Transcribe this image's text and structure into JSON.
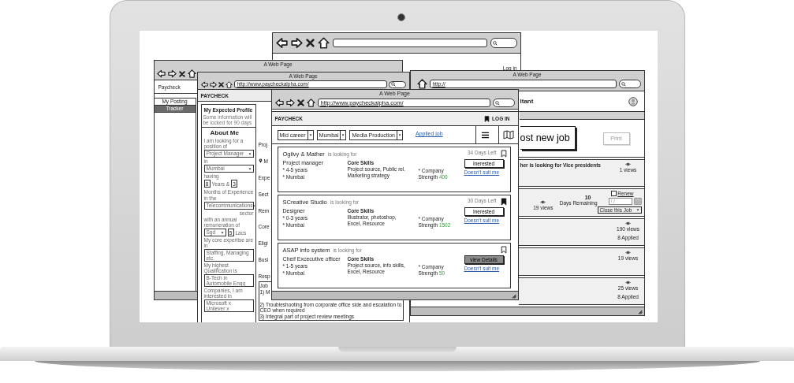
{
  "back_window": {
    "link": "Log in"
  },
  "posting_window": {
    "title": "A Web Page",
    "brand": "Paycheck",
    "menu": [
      {
        "label": "My Posting",
        "selected": false
      },
      {
        "label": "Tracker",
        "selected": true
      }
    ]
  },
  "profile_window": {
    "title": "A Web Page",
    "url": "http://www.paycheckalpha.com/",
    "brand": "PAYCHECK",
    "panel_title": "My Expected Profile",
    "panel_note": "Some information will be locked for 90 days",
    "section_title": "About Me",
    "form": [
      {
        "kind": "label",
        "text": "I am looking for a position of"
      },
      {
        "kind": "select",
        "value": "Project Manager"
      },
      {
        "kind": "label",
        "text": "in"
      },
      {
        "kind": "select",
        "value": "Mumbai"
      },
      {
        "kind": "label",
        "text": "having"
      },
      {
        "kind": "experience",
        "years": "8",
        "years_label": "Years &",
        "months": "3",
        "months_label": "Months of Experience"
      },
      {
        "kind": "label",
        "text": "in the"
      },
      {
        "kind": "select",
        "value": "Telecommunications"
      },
      {
        "kind": "note",
        "text": "sector"
      },
      {
        "kind": "label",
        "text": "with an annual remuneration of"
      },
      {
        "kind": "salary",
        "currency": "Sgd",
        "amount": "5",
        "unit": "Lacs"
      },
      {
        "kind": "label",
        "text": "My core expertise are in"
      },
      {
        "kind": "field",
        "value": "Staffing, Managing etc."
      },
      {
        "kind": "label",
        "text": "My highest Qualification is"
      },
      {
        "kind": "field",
        "value": "B-Tech in Automobile Engg"
      },
      {
        "kind": "label",
        "text": "Companies, I am interested in"
      },
      {
        "kind": "tags",
        "tags": [
          "Microsoft x",
          "Unilever x"
        ]
      }
    ],
    "main_rows": [
      {
        "kind": "label",
        "text": "Proj"
      },
      {
        "kind": "location",
        "text": "M"
      },
      {
        "kind": "label",
        "text": "Expe"
      },
      {
        "kind": "label",
        "text": "Sect"
      },
      {
        "kind": "label",
        "text": "Rem"
      },
      {
        "kind": "label",
        "text": "Core"
      },
      {
        "kind": "label",
        "text": "Eligi"
      },
      {
        "kind": "label",
        "text": "Busi"
      },
      {
        "kind": "label",
        "text": "Resp"
      }
    ],
    "job": {
      "legend": "Job",
      "lines": [
        "1) M",
        "2) Troubleshooting from corporate office side and escalation to CEO when required",
        "3) Integral part of project review meetings"
      ]
    }
  },
  "tracker_window": {
    "title": "A Web Page",
    "url": "http://",
    "brand": "ltant",
    "post_button": "ost new job",
    "print_button": {
      "label": "Print",
      "disabled": true
    },
    "rows": [
      {
        "kind": "posting",
        "title": "her is looking for Vice presidents",
        "views": "1 views"
      },
      {
        "kind": "expiring",
        "days": "10",
        "days_label": "Days Remaining",
        "renew": {
          "label": "Renew",
          "checked": false
        },
        "date_placeholder": "/ /",
        "views": "19 views",
        "close_action": "Close this Job"
      },
      {
        "kind": "posting",
        "views": "190 views",
        "applied": "8 Applied"
      },
      {
        "kind": "posting",
        "views": "19 views"
      },
      {
        "kind": "posting",
        "views": "25 views",
        "applied": "8 Applied"
      }
    ]
  },
  "jobs_window": {
    "title": "A Web Page",
    "url": "http://www.paycheckalpha.com/",
    "brand": "PAYCHECK",
    "login": "LOG IN",
    "filters": [
      "Mid career",
      "Mumbai",
      "Media Production"
    ],
    "applied_link": "Applied job",
    "cards": [
      {
        "company": "Ogilvy & Mather",
        "looking": "is looking for",
        "days_left": "34 Days Left",
        "saved": false,
        "role": "Project manager",
        "details": [
          "* 4-5 years",
          "* Mumbai"
        ],
        "skills_title": "Core Skills",
        "skills": [
          "Project source, Public rel.",
          "Marketing strategy"
        ],
        "strength_label": "* Company Strength",
        "strength": "400",
        "action": {
          "label": "Inerested",
          "kind": "outline"
        },
        "dismiss": "Doesn't suit me"
      },
      {
        "company": "SCreative Studio",
        "looking": "is looking for",
        "days_left": "30 Days Left",
        "saved": true,
        "role": "Designer",
        "details": [
          "* 0-3 years",
          "* Mumbai"
        ],
        "skills_title": "Core Skills",
        "skills": [
          "Illustrator, photoshop,",
          "Excel, Resource"
        ],
        "strength_label": "* Company Strength",
        "strength": "1502",
        "action": {
          "label": "Inerested",
          "kind": "outline"
        },
        "dismiss": "Doesn't suit me"
      },
      {
        "company": "ASAP info system",
        "looking": "is looking for",
        "saved": false,
        "role": "Cheif Excecutive officer",
        "details": [
          "* 1-5 years",
          "* Mumbai"
        ],
        "skills_title": "Core Skills",
        "skills": [
          "Project source, info skills,",
          "Excel, Resource"
        ],
        "strength_label": "* Company Strength",
        "strength": "50",
        "action": {
          "label": "view Details",
          "kind": "filled"
        },
        "dismiss": "Doesn't suit me"
      }
    ]
  }
}
